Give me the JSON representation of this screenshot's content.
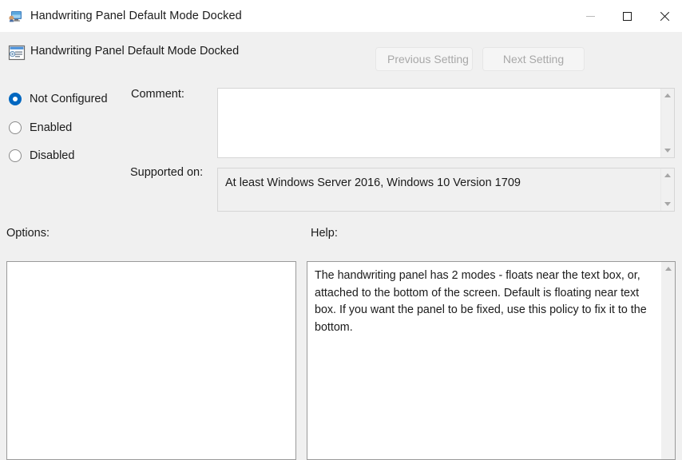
{
  "window": {
    "title": "Handwriting Panel Default Mode Docked",
    "icon": "computer-monitor-icon",
    "controls": {
      "minimize": "minimize-icon",
      "maximize": "maximize-icon",
      "close": "close-icon"
    }
  },
  "header": {
    "icon": "policy-setting-icon",
    "title": "Handwriting Panel Default Mode Docked",
    "previous_label": "Previous Setting",
    "next_label": "Next Setting",
    "previous_enabled": false,
    "next_enabled": false
  },
  "state": {
    "selected": "Not Configured",
    "options": [
      {
        "label": "Not Configured",
        "checked": true
      },
      {
        "label": "Enabled",
        "checked": false
      },
      {
        "label": "Disabled",
        "checked": false
      }
    ]
  },
  "comment": {
    "label": "Comment:",
    "value": ""
  },
  "supported_on": {
    "label": "Supported on:",
    "value": "At least Windows Server 2016, Windows 10 Version 1709"
  },
  "options_panel": {
    "label": "Options:",
    "value": ""
  },
  "help_panel": {
    "label": "Help:",
    "value": "The handwriting panel has 2 modes - floats near the text box, or, attached to the bottom of the screen. Default is floating near text box. If you want the panel to be fixed, use this policy to fix it to the bottom."
  },
  "scrollbars": {
    "up_icon": "scroll-up-arrow-icon",
    "down_icon": "scroll-down-arrow-icon"
  },
  "colors": {
    "accent": "#0067C0",
    "window_background": "#F0F0F0",
    "titlebar_background": "#FFFFFF",
    "field_background": "#FFFFFF",
    "text": "#1B1B1B",
    "disabled_text": "#A8A8A8",
    "border": "#9A9A9A"
  }
}
